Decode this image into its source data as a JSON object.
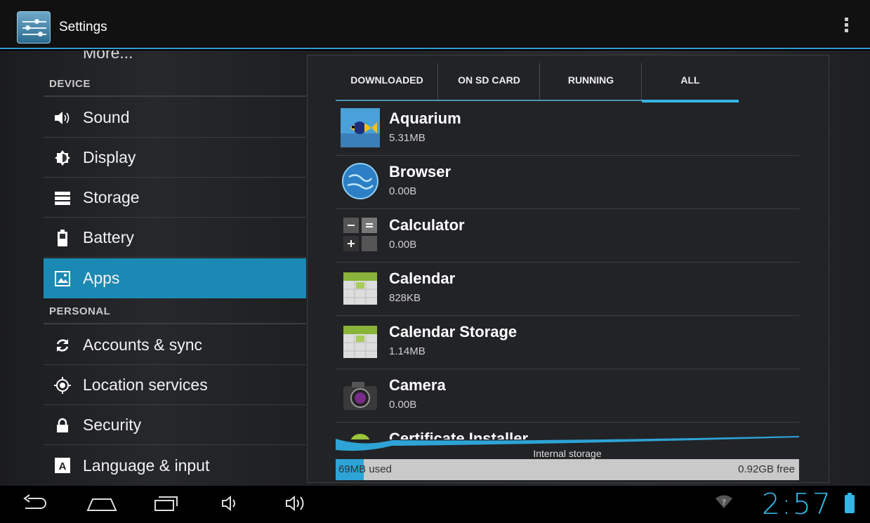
{
  "actionbar": {
    "title": "Settings",
    "icon": "settings-sliders-icon",
    "overflow_icon": "overflow-menu-icon"
  },
  "sidebar": {
    "partial_item": "More...",
    "sections": [
      {
        "header": "DEVICE"
      },
      {
        "header": "PERSONAL"
      }
    ],
    "items": [
      {
        "label": "Sound",
        "icon": "speaker-icon"
      },
      {
        "label": "Display",
        "icon": "brightness-icon"
      },
      {
        "label": "Storage",
        "icon": "storage-icon"
      },
      {
        "label": "Battery",
        "icon": "battery-icon"
      },
      {
        "label": "Apps",
        "icon": "apps-icon",
        "selected": true
      },
      {
        "label": "Accounts & sync",
        "icon": "sync-icon"
      },
      {
        "label": "Location services",
        "icon": "location-icon"
      },
      {
        "label": "Security",
        "icon": "lock-icon"
      },
      {
        "label": "Language & input",
        "icon": "keyboard-language-icon"
      }
    ]
  },
  "tabs": [
    {
      "label": "DOWNLOADED"
    },
    {
      "label": "ON SD CARD"
    },
    {
      "label": "RUNNING"
    },
    {
      "label": "ALL",
      "active": true
    }
  ],
  "apps": [
    {
      "name": "Aquarium",
      "size": "5.31MB",
      "icon": "aquarium-fish-icon"
    },
    {
      "name": "Browser",
      "size": "0.00B",
      "icon": "globe-icon"
    },
    {
      "name": "Calculator",
      "size": "0.00B",
      "icon": "calculator-icon"
    },
    {
      "name": "Calendar",
      "size": "828KB",
      "icon": "calendar-icon"
    },
    {
      "name": "Calendar Storage",
      "size": "1.14MB",
      "icon": "calendar-icon"
    },
    {
      "name": "Camera",
      "size": "0.00B",
      "icon": "camera-icon"
    },
    {
      "name": "Certificate Installer",
      "size": "",
      "icon": "android-icon"
    }
  ],
  "storage": {
    "label": "Internal storage",
    "used": "69MB used",
    "free": "0.92GB free",
    "used_fraction": 0.06
  },
  "navbar": {
    "time": "2:57",
    "accent_color": "#34b5e5",
    "icons": [
      "back-icon",
      "home-icon",
      "recent-apps-icon",
      "volume-down-icon",
      "volume-up-icon",
      "wifi-icon",
      "battery-icon"
    ]
  }
}
